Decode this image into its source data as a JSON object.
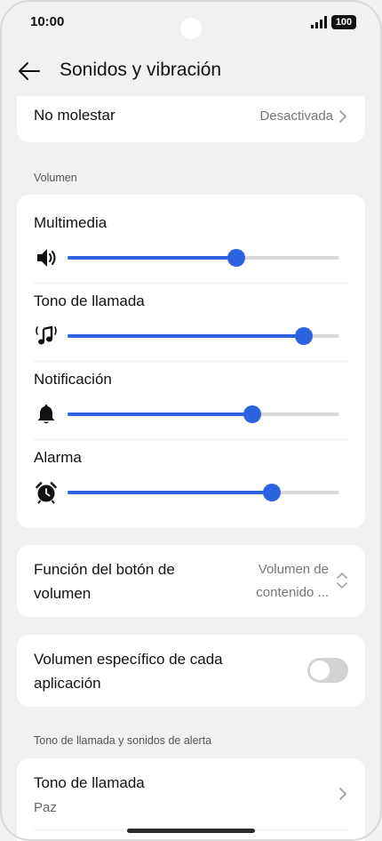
{
  "status": {
    "time": "10:00",
    "battery": "100"
  },
  "header": {
    "title": "Sonidos y vibración"
  },
  "dnd": {
    "label": "No molestar",
    "value": "Desactivada"
  },
  "volume": {
    "section_label": "Volumen",
    "items": [
      {
        "label": "Multimedia",
        "icon": "speaker-icon",
        "level": 0.62
      },
      {
        "label": "Tono de llamada",
        "icon": "ringtone-icon",
        "level": 0.87
      },
      {
        "label": "Notificación",
        "icon": "bell-icon",
        "level": 0.68
      },
      {
        "label": "Alarma",
        "icon": "alarm-clock-icon",
        "level": 0.75
      }
    ]
  },
  "volume_button": {
    "label_line1": "Función del botón de",
    "label_line2": "volumen",
    "value_line1": "Volumen de",
    "value_line2": "contenido ..."
  },
  "app_volume": {
    "label_line1": "Volumen específico de cada",
    "label_line2": "aplicación",
    "enabled": false
  },
  "ringtones": {
    "section_label": "Tono de llamada y sonidos de alerta",
    "ringtone_label": "Tono de llamada",
    "ringtone_value": "Paz"
  },
  "colors": {
    "accent": "#2b63df",
    "background": "#f1f1f3"
  }
}
